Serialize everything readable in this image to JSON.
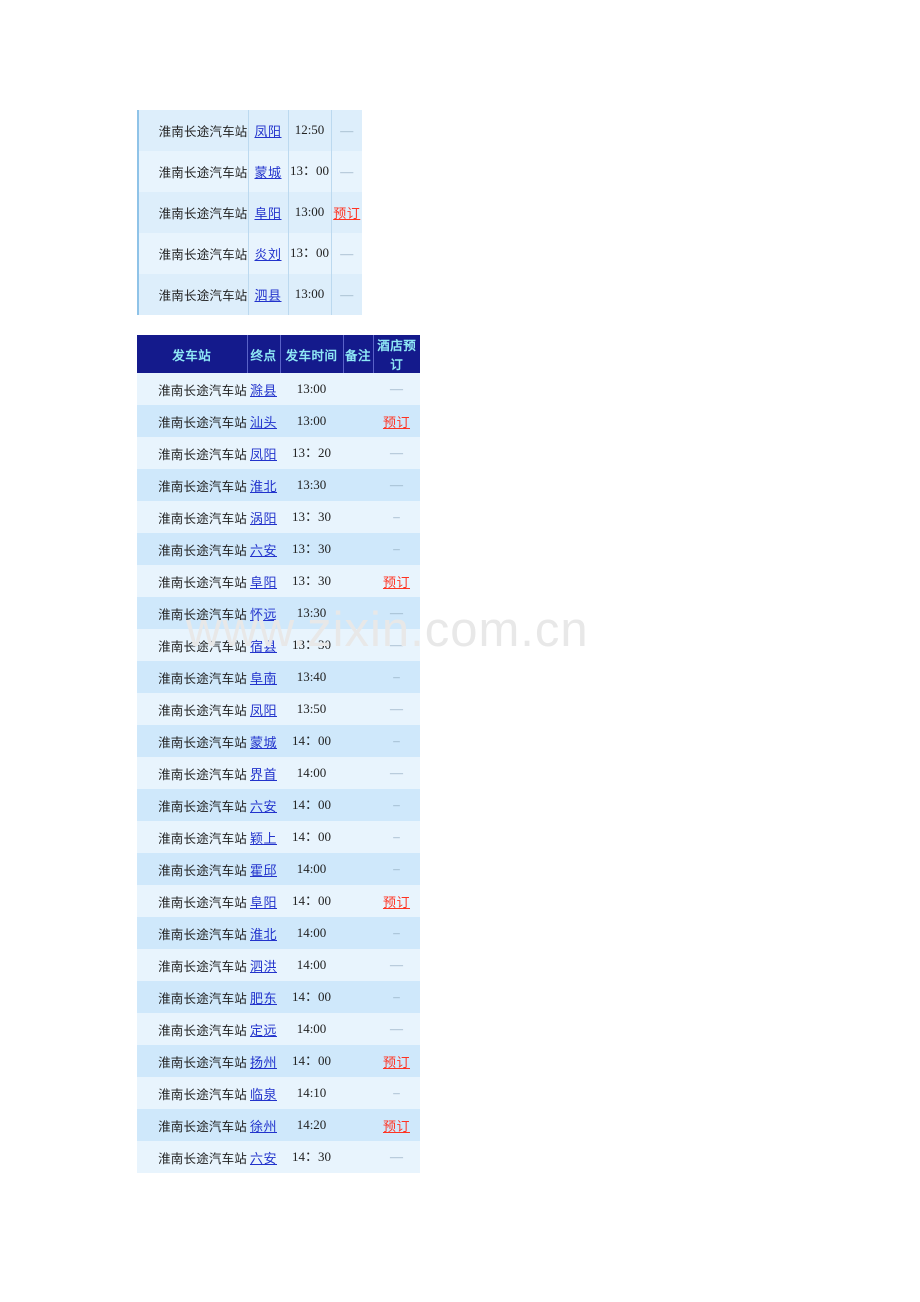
{
  "page": {
    "watermark": "www.zixin.com.cn"
  },
  "table1": {
    "name": "bus-schedule-fragment",
    "rows": [
      {
        "origin": "淮南长途汽车站",
        "destination": "凤阳",
        "time": "12:50",
        "note": "",
        "booking": "—"
      },
      {
        "origin": "淮南长途汽车站",
        "destination": "蒙城",
        "time": "13：00",
        "note": "",
        "booking": "—"
      },
      {
        "origin": "淮南长途汽车站",
        "destination": "阜阳",
        "time": "13:00",
        "note": "",
        "booking": "预订"
      },
      {
        "origin": "淮南长途汽车站",
        "destination": "炎刘",
        "time": "13：00",
        "note": "",
        "booking": "—"
      },
      {
        "origin": "淮南长途汽车站",
        "destination": "泗县",
        "time": "13:00",
        "note": "",
        "booking": "—"
      }
    ]
  },
  "table2": {
    "name": "bus-schedule-main",
    "headers": {
      "origin": "发车站",
      "destination": "终点",
      "time": "发车时间",
      "note": "备注",
      "booking": "酒店预订"
    },
    "rows": [
      {
        "origin": "淮南长途汽车站",
        "destination": "滁县",
        "time": "13:00",
        "note": "",
        "booking": "—"
      },
      {
        "origin": "淮南长途汽车站",
        "destination": "汕头",
        "time": "13:00",
        "note": "",
        "booking": "预订"
      },
      {
        "origin": "淮南长途汽车站",
        "destination": "凤阳",
        "time": "13：20",
        "note": "",
        "booking": "—"
      },
      {
        "origin": "淮南长途汽车站",
        "destination": "淮北",
        "time": "13:30",
        "note": "",
        "booking": "—"
      },
      {
        "origin": "淮南长途汽车站",
        "destination": "涡阳",
        "time": "13：30",
        "note": "",
        "booking": "–"
      },
      {
        "origin": "淮南长途汽车站",
        "destination": "六安",
        "time": "13：30",
        "note": "",
        "booking": "–"
      },
      {
        "origin": "淮南长途汽车站",
        "destination": "阜阳",
        "time": "13：30",
        "note": "",
        "booking": "预订"
      },
      {
        "origin": "淮南长途汽车站",
        "destination": "怀远",
        "time": "13:30",
        "note": "",
        "booking": "—"
      },
      {
        "origin": "淮南长途汽车站",
        "destination": "宿县",
        "time": "13：30",
        "note": "",
        "booking": "—"
      },
      {
        "origin": "淮南长途汽车站",
        "destination": "阜南",
        "time": "13:40",
        "note": "",
        "booking": "–"
      },
      {
        "origin": "淮南长途汽车站",
        "destination": "凤阳",
        "time": "13:50",
        "note": "",
        "booking": "—"
      },
      {
        "origin": "淮南长途汽车站",
        "destination": "蒙城",
        "time": "14：00",
        "note": "",
        "booking": "–"
      },
      {
        "origin": "淮南长途汽车站",
        "destination": "界首",
        "time": "14:00",
        "note": "",
        "booking": "—"
      },
      {
        "origin": "淮南长途汽车站",
        "destination": "六安",
        "time": "14：00",
        "note": "",
        "booking": "–"
      },
      {
        "origin": "淮南长途汽车站",
        "destination": "颖上",
        "time": "14：00",
        "note": "",
        "booking": "–"
      },
      {
        "origin": "淮南长途汽车站",
        "destination": "霍邱",
        "time": "14:00",
        "note": "",
        "booking": "–"
      },
      {
        "origin": "淮南长途汽车站",
        "destination": "阜阳",
        "time": "14：00",
        "note": "",
        "booking": "预订"
      },
      {
        "origin": "淮南长途汽车站",
        "destination": "淮北",
        "time": "14:00",
        "note": "",
        "booking": "–"
      },
      {
        "origin": "淮南长途汽车站",
        "destination": "泗洪",
        "time": "14:00",
        "note": "",
        "booking": "—"
      },
      {
        "origin": "淮南长途汽车站",
        "destination": "肥东",
        "time": "14：00",
        "note": "",
        "booking": "–"
      },
      {
        "origin": "淮南长途汽车站",
        "destination": "定远",
        "time": "14:00",
        "note": "",
        "booking": "—"
      },
      {
        "origin": "淮南长途汽车站",
        "destination": "扬州",
        "time": "14：00",
        "note": "",
        "booking": "预订"
      },
      {
        "origin": "淮南长途汽车站",
        "destination": "临泉",
        "time": "14:10",
        "note": "",
        "booking": "–"
      },
      {
        "origin": "淮南长途汽车站",
        "destination": "徐州",
        "time": "14:20",
        "note": "",
        "booking": "预订"
      },
      {
        "origin": "淮南长途汽车站",
        "destination": "六安",
        "time": "14：30",
        "note": "",
        "booking": "—"
      }
    ]
  }
}
